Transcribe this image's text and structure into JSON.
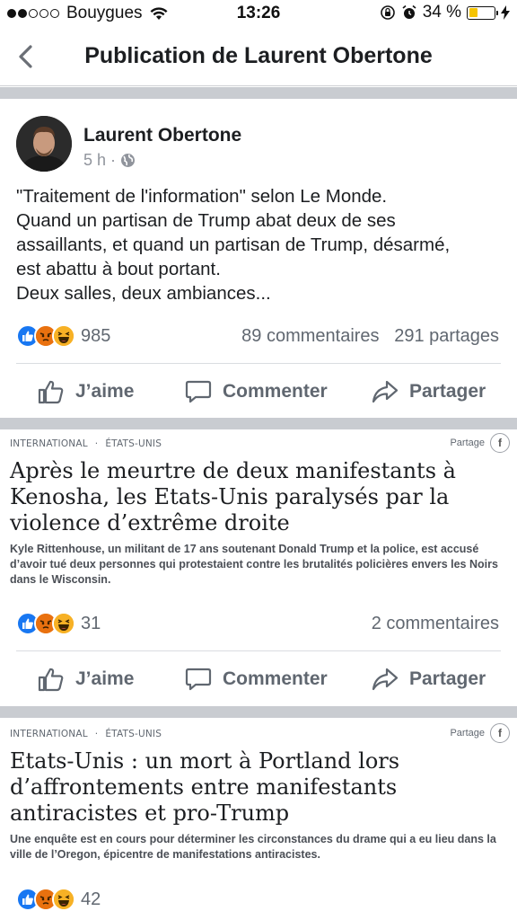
{
  "status_bar": {
    "carrier": "Bouygues",
    "time": "13:26",
    "battery": "34 %",
    "battery_level": 0.34
  },
  "header": {
    "title": "Publication de Laurent Obertone"
  },
  "post": {
    "author": "Laurent Obertone",
    "time": "5 h",
    "text_lines": [
      "\"Traitement de l'information\" selon Le Monde.",
      "Quand un partisan de Trump abat deux de ses",
      "assaillants, et quand un partisan de Trump, désarmé,",
      "est abattu à bout portant.",
      "Deux salles, deux ambiances..."
    ],
    "reactions": "985",
    "comments": "89 commentaires",
    "shares": "291 partages"
  },
  "actions": {
    "like": "J’aime",
    "comment": "Commenter",
    "share": "Partager"
  },
  "articles": [
    {
      "category": "INTERNATIONAL",
      "subcategory": "ÉTATS-UNIS",
      "share_label": "Partage",
      "title_lines": [
        "Après le meurtre de deux manifestants à",
        "Kenosha, les Etats-Unis paralysés par la",
        "violence d’extrême droite"
      ],
      "description": "Kyle Rittenhouse, un militant de 17 ans soutenant Donald Trump et la police, est accusé d’avoir tué deux personnes qui protestaient contre les brutalités policières envers les Noirs dans le Wisconsin.",
      "reactions": "31",
      "comments": "2 commentaires"
    },
    {
      "category": "INTERNATIONAL",
      "subcategory": "ÉTATS-UNIS",
      "share_label": "Partage",
      "title_lines": [
        "Etats-Unis : un mort à Portland lors",
        "d’affrontements entre manifestants",
        "antiracistes et pro-Trump"
      ],
      "description": "Une enquête est en cours pour déterminer les circonstances du drame qui a eu lieu dans la ville de l’Oregon, épicentre de manifestations antiracistes.",
      "reactions": "42"
    }
  ],
  "colors": {
    "like_blue": "#1877f2",
    "angry_orange": "#e9710f",
    "haha_yellow": "#f7b125",
    "divider": "#c9ccd1",
    "battery_yellow": "#f5c400"
  }
}
